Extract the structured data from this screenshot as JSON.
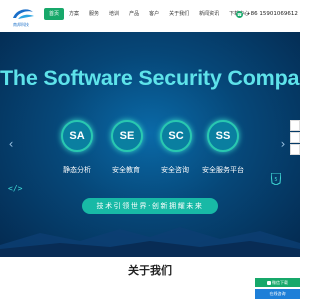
{
  "header": {
    "logo_text": "南邦科技",
    "nav": [
      "首页",
      "方案",
      "服务",
      "培训",
      "产品",
      "客户",
      "关于我们",
      "新闻资讯",
      "下载中心"
    ],
    "phone": "+86 15901069612"
  },
  "hero": {
    "title": "The Software Security Company",
    "services": [
      {
        "abbr": "SA",
        "label": "静态分析"
      },
      {
        "abbr": "SE",
        "label": "安全教育"
      },
      {
        "abbr": "SC",
        "label": "安全咨询"
      },
      {
        "abbr": "SS",
        "label": "安全服务平台"
      }
    ],
    "slogan": "技术引领世界·创新拥耀未来",
    "prev_arrow": "‹",
    "next_arrow": "›"
  },
  "about": {
    "title": "关于我们"
  },
  "float": {
    "wechat_label": "微信下载",
    "chat_label": "在线咨询"
  },
  "colors": {
    "accent": "#17a86a",
    "hero_title": "#5ee3ea",
    "slogan_bg": "#18b9a6",
    "chat_bg": "#1e7fd8"
  }
}
